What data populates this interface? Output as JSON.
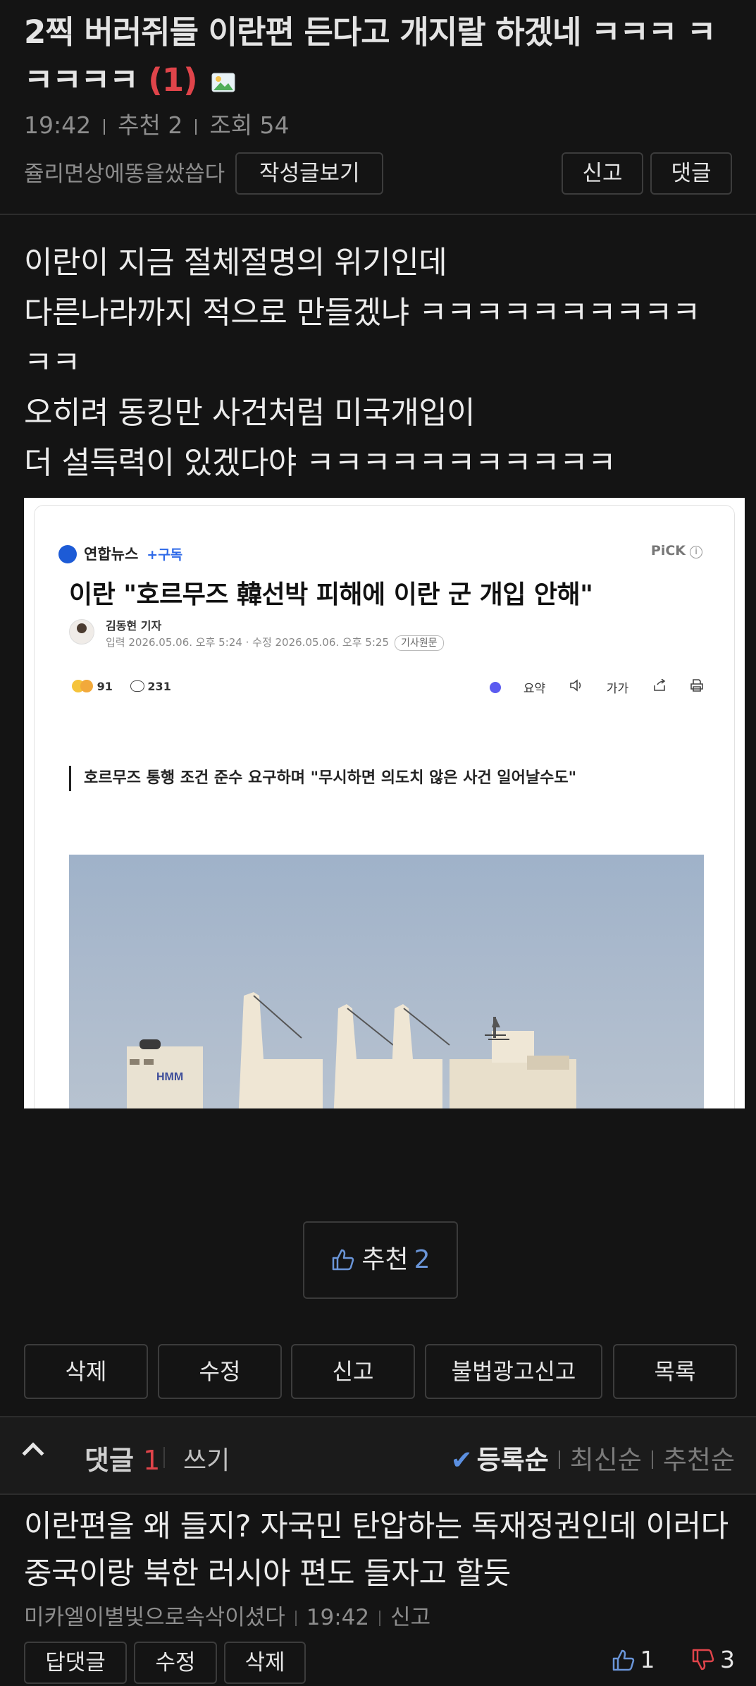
{
  "post": {
    "title": "2찍 버러쥐들 이란편 든다고 개지랄 하겠네 ㅋㅋㅋ ㅋㅋㅋㅋㅋ",
    "comment_count": "(1)",
    "time": "19:42",
    "recommend_label": "추천 2",
    "views_label": "조회 54",
    "author": "쥴리면상에똥을쌌씁다",
    "author_posts_button": "작성글보기",
    "report_button": "신고",
    "reply_button": "댓글",
    "body_lines": [
      "이란이 지금 절체절명의 위기인데",
      "다른나라까지 적으로 만들겠냐 ㅋㅋㅋㅋㅋㅋㅋㅋㅋㅋ ㅋㅋ",
      "오히려 동킹만 사건처럼 미국개입이",
      "더 설득력이 있겠다야 ㅋㅋㅋㅋㅋㅋㅋㅋㅋㅋㅋ"
    ]
  },
  "article": {
    "source": "연합뉴스",
    "subscribe": "+구독",
    "pick": "PiCK",
    "pick_info": "i",
    "headline": "이란 \"호르무즈 韓선박 피해에 이란 군 개입 안해\"",
    "reporter": "김동현 기자",
    "dates": "입력 2026.05.06. 오후 5:24 · 수정 2026.05.06. 오후 5:25",
    "original_badge": "기사원문",
    "reaction_count": "91",
    "comment_count": "231",
    "tool_summary": "요약",
    "tool_font": "가가",
    "summary_line": "호르무즈 통행 조건 준수 요구하며 \"무시하면 의도치 않은 사건 일어날수도\"",
    "ship_text": "HMM"
  },
  "recommend": {
    "label": "추천",
    "count": "2"
  },
  "actions": {
    "delete": "삭제",
    "edit": "수정",
    "report": "신고",
    "illegal_ad_report": "불법광고신고",
    "list": "목록"
  },
  "comments_bar": {
    "label": "댓글",
    "count": "1",
    "write": "쓰기",
    "sort_registered": "등록순",
    "sort_latest": "최신순",
    "sort_recommended": "추천순"
  },
  "comment": {
    "text": "이란편을 왜 들지? 자국민 탄압하는 독재정권인데 이러다 중국이랑 북한 러시아 편도 들자고 할듯",
    "author": "미카엘이별빛으로속삭이셨다",
    "time": "19:42",
    "report": "신고",
    "reply_button": "답댓글",
    "edit_button": "수정",
    "delete_button": "삭제",
    "likes": "1",
    "dislikes": "3"
  },
  "colors": {
    "background": "#141414",
    "accent_red": "#e0444a",
    "accent_blue": "#6a95d8"
  }
}
